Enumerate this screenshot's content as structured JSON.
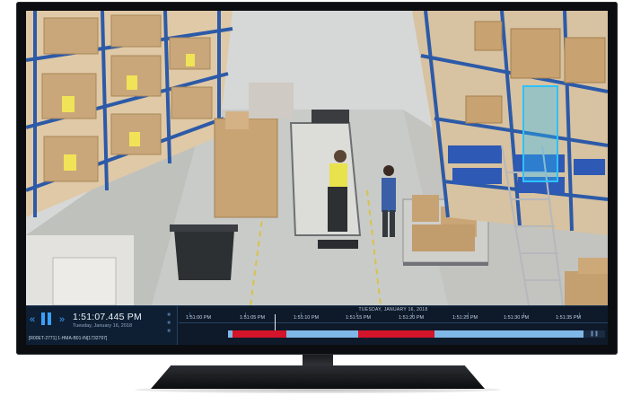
{
  "player": {
    "current_time": "1:51:07.445 PM",
    "current_date": "Tuesday, January 16, 2018",
    "camera_label": "[R00ET-2771] 1-HMA-B01-IN[1732797]"
  },
  "timeline": {
    "date_header": "TUESDAY, JANUARY 16, 2018",
    "ticks": [
      "1:51:00 PM",
      "1:51:05 PM",
      "1:51:10 PM",
      "1:51:15 PM",
      "1:51:20 PM",
      "1:51:25 PM",
      "1:51:30 PM",
      "1:51:35 PM"
    ]
  },
  "colors": {
    "accent": "#3aa0ff",
    "motion_segment": "#d4142a",
    "track": "#7fb8e6",
    "tracker_box": "#2cc3ff"
  },
  "icons": [
    "previous-frame-icon",
    "pause-icon",
    "next-frame-icon",
    "panel-options-icon"
  ]
}
